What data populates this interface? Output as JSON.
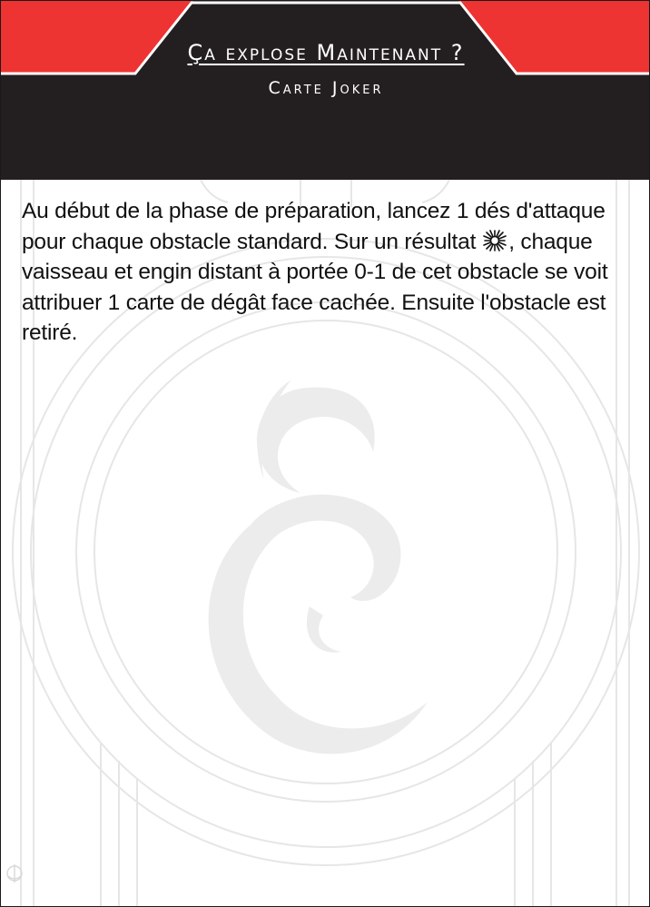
{
  "card": {
    "title": "Ça explose Maintenant ?",
    "subtitle": "Carte Joker",
    "text_before_icon": "Au début de la phase de préparation, lancez 1 dés d'attaque pour chaque obstacle standard. Sur un résultat",
    "result_icon": "hit-icon",
    "text_after_icon": ", chaque vaisseau et engin distant à portée 0-1 de cet obstacle se voit attribuer 1 carte de dégât face cachée. Ensuite l'obstacle est retiré."
  },
  "colors": {
    "header_black": "#231f20",
    "header_red": "#ee3333",
    "text": "#111111",
    "watermark": "#e6e6e6"
  }
}
